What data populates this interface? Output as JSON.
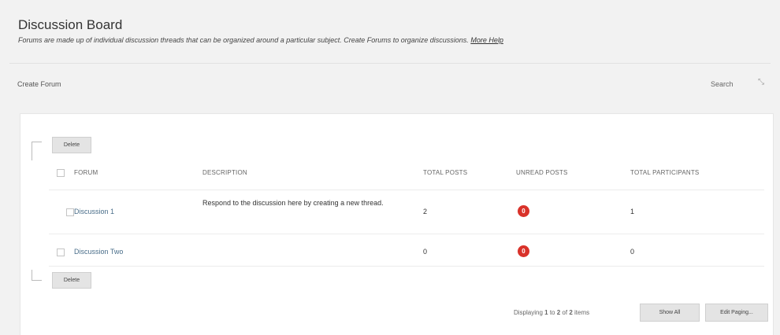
{
  "page": {
    "title": "Discussion Board",
    "description": "Forums are made up of individual discussion threads that can be organized around a particular subject. Create Forums to organize discussions.",
    "help_link": "More Help"
  },
  "toolbar": {
    "create_forum": "Create Forum",
    "search": "Search",
    "search_toggle_icon": "expand-arrows-icon"
  },
  "table": {
    "delete_label": "Delete",
    "columns": [
      "FORUM",
      "DESCRIPTION",
      "TOTAL POSTS",
      "UNREAD POSTS",
      "TOTAL PARTICIPANTS"
    ],
    "rows": [
      {
        "forum": "Discussion 1",
        "description": "Respond to the discussion here by creating a new thread.",
        "total_posts": "2",
        "unread_posts": "0",
        "total_participants": "1"
      },
      {
        "forum": "Discussion Two",
        "description": "",
        "total_posts": "0",
        "unread_posts": "0",
        "total_participants": "0"
      }
    ]
  },
  "footer": {
    "displaying_prefix": "Displaying",
    "from": "1",
    "to_word": "to",
    "to": "2",
    "of_word": "of",
    "total": "2",
    "items_word": "items",
    "show_all": "Show All",
    "edit_paging": "Edit Paging..."
  },
  "colors": {
    "badge": "#d9322a",
    "link": "#4a6e8a",
    "background": "#f2f2f2"
  }
}
